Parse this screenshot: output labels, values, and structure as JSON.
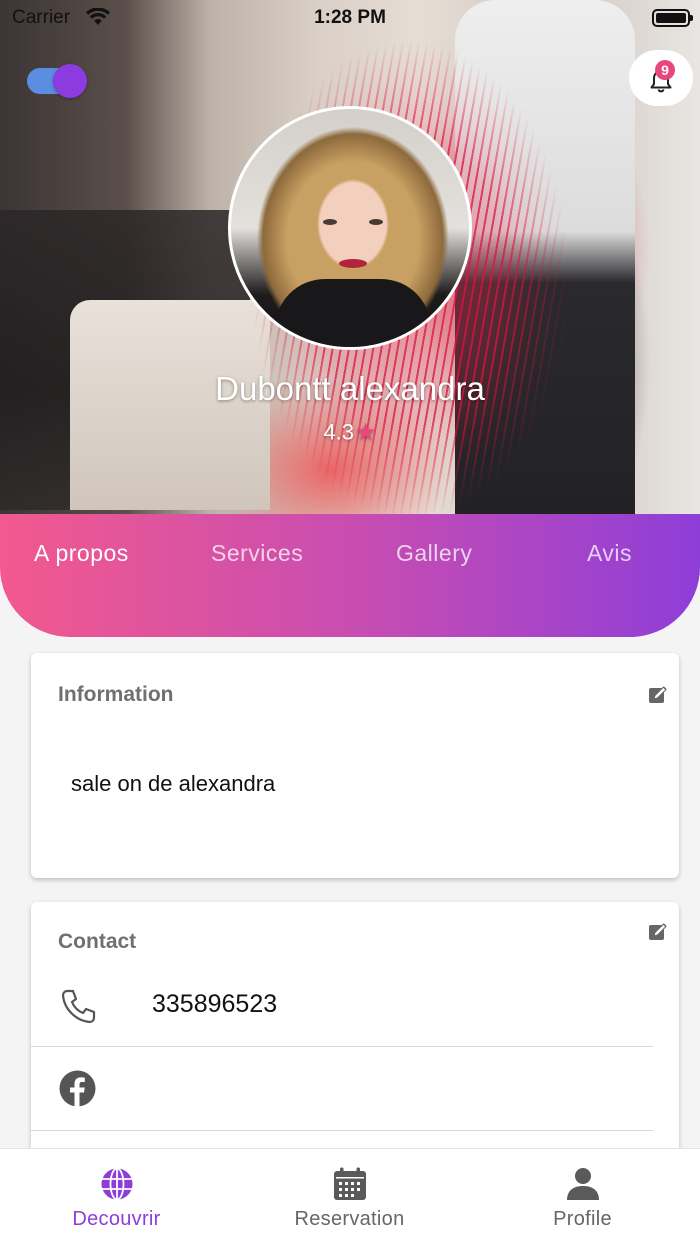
{
  "status_bar": {
    "carrier": "Carrier",
    "time": "1:28 PM"
  },
  "header": {
    "toggle_on": true,
    "notification_count": "9",
    "profile_name": "Dubontt alexandra",
    "rating": "4.3"
  },
  "tabs": [
    {
      "label": "A propos",
      "active": true
    },
    {
      "label": "Services",
      "active": false
    },
    {
      "label": "Gallery",
      "active": false
    },
    {
      "label": "Avis",
      "active": false
    }
  ],
  "information": {
    "title": "Information",
    "text": "sale on de alexandra"
  },
  "contact": {
    "title": "Contact",
    "phone": "335896523",
    "facebook": ""
  },
  "bottom_nav": [
    {
      "label": "Decouvrir",
      "icon": "globe-icon",
      "active": true
    },
    {
      "label": "Reservation",
      "icon": "calendar-icon",
      "active": false
    },
    {
      "label": "Profile",
      "icon": "person-icon",
      "active": false
    }
  ],
  "colors": {
    "accent_purple": "#8e3ed8",
    "accent_pink": "#f2598e",
    "badge": "#e8477c"
  }
}
